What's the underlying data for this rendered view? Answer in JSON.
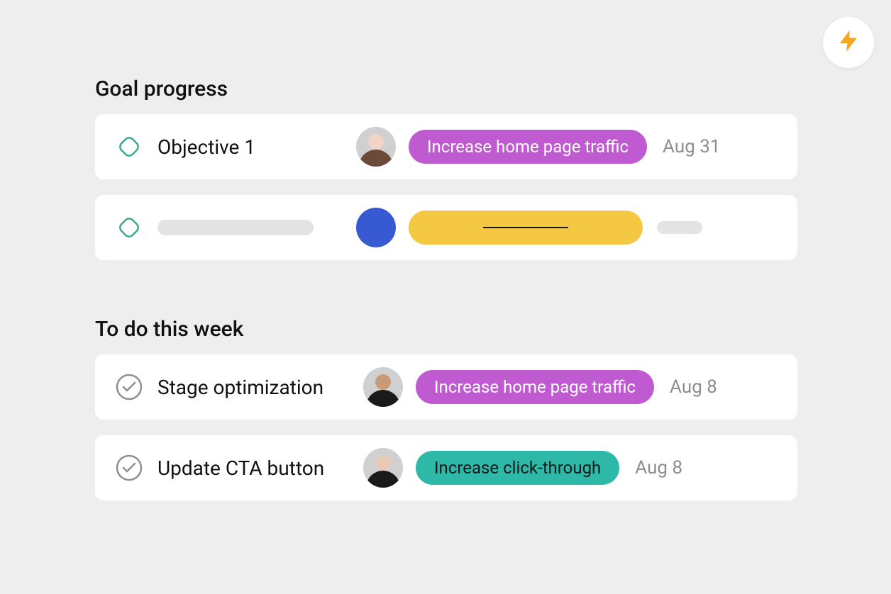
{
  "fab": {
    "icon": "lightning-icon",
    "color": "#f5a623"
  },
  "goal_section": {
    "title": "Goal progress",
    "items": [
      {
        "title": "Objective 1",
        "tag_label": "Increase home page traffic",
        "tag_style": "purple",
        "date": "Aug 31",
        "avatar": "person-1"
      },
      {
        "placeholder": true,
        "tag_style": "yellow",
        "avatar_style": "blue"
      }
    ]
  },
  "todo_section": {
    "title": "To do this week",
    "items": [
      {
        "title": "Stage optimization",
        "tag_label": "Increase home page traffic",
        "tag_style": "purple",
        "date": "Aug 8",
        "avatar": "person-2"
      },
      {
        "title": "Update CTA button",
        "tag_label": "Increase click-through",
        "tag_style": "teal",
        "date": "Aug 8",
        "avatar": "person-3"
      }
    ]
  },
  "colors": {
    "purple": "#c05ad1",
    "teal": "#2db8a7",
    "yellow": "#f5c844",
    "blue": "#3759d1",
    "muted": "#8e8e8e"
  }
}
